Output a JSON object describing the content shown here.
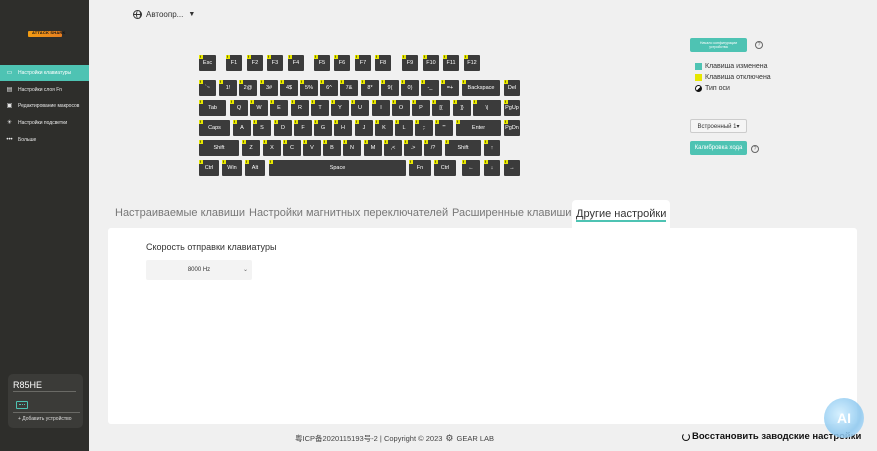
{
  "brand": {
    "logo_text": "ATTACK SHARK"
  },
  "sidebar": {
    "items": [
      {
        "label": "Настройки клавиатуры",
        "icon": "keyboard-icon",
        "active": true
      },
      {
        "label": "Настройки слоя Fn",
        "icon": "layer-icon",
        "active": false
      },
      {
        "label": "Редактирование макросов",
        "icon": "macro-icon",
        "active": false
      },
      {
        "label": "Настройки подсветки",
        "icon": "light-icon",
        "active": false
      },
      {
        "label": "Больше",
        "icon": "more-icon",
        "active": false
      }
    ],
    "device": {
      "name": "R85HE",
      "add_label": "+ Добавить устройство"
    }
  },
  "profile": {
    "label": "Автоопр..."
  },
  "keyboard": {
    "rows": [
      [
        "Esc",
        "F1",
        "F2",
        "F3",
        "F4",
        "F5",
        "F6",
        "F7",
        "F8",
        "F9",
        "F10",
        "F11",
        "F12"
      ],
      [
        "`~",
        "1!",
        "2@",
        "3#",
        "4$",
        "5%",
        "6^",
        "7&",
        "8*",
        "9(",
        "0)",
        "-_",
        "=+",
        "Backspace",
        "Del"
      ],
      [
        "Tab",
        "Q",
        "W",
        "E",
        "R",
        "T",
        "Y",
        "U",
        "I",
        "O",
        "P",
        "[{",
        "]}",
        "\\|",
        "PgUp"
      ],
      [
        "Caps",
        "A",
        "S",
        "D",
        "F",
        "G",
        "H",
        "J",
        "K",
        "L",
        ";:",
        "'\"",
        "Enter",
        "PgDn"
      ],
      [
        "Shift",
        "Z",
        "X",
        "C",
        "V",
        "B",
        "N",
        "M",
        ",<",
        ".>",
        "/?",
        "Shift",
        "↑"
      ],
      [
        "Ctrl",
        "Win",
        "Alt",
        "Space",
        "Fn",
        "Ctrl",
        "←",
        "↓",
        "→"
      ]
    ]
  },
  "right_panel": {
    "restore_button": "Начало конфигурации устройства",
    "legend": [
      {
        "label": "Клавиша изменена",
        "color": "#4ec3b3"
      },
      {
        "label": "Клавиша отключена",
        "color": "#e6e600"
      },
      {
        "label": "Тип оси",
        "color": "#111111"
      }
    ],
    "builtin_select": "Встроенный 1▾",
    "calibrate_button": "Калибровка хода"
  },
  "tabs": [
    {
      "label": "Настраиваемые клавиши",
      "active": false
    },
    {
      "label": "Настройки магнитных переключателей",
      "active": false
    },
    {
      "label": "Расширенные клавиши",
      "active": false
    },
    {
      "label": "Другие настройки",
      "active": true
    }
  ],
  "panel": {
    "polling_label": "Скорость отправки клавиатуры",
    "polling_value": "8000 Hz"
  },
  "footer": {
    "copyright": "粤ICP备2020115193号-2 | Copyright © 2023",
    "brand": "GEAR LAB",
    "reset_label": "Восстановить заводские настройки"
  },
  "ai_badge": "AI"
}
